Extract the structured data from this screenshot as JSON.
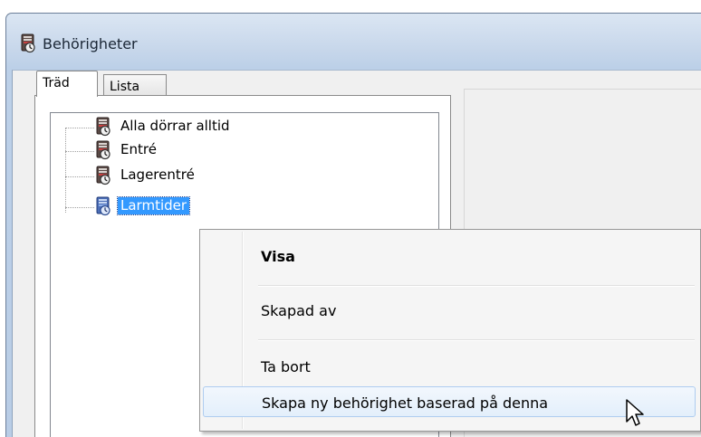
{
  "window": {
    "title": "Behörigheter",
    "icon": "access-permission-icon"
  },
  "tabs": [
    {
      "label": "Träd",
      "active": true
    },
    {
      "label": "Lista",
      "active": false
    }
  ],
  "tree": {
    "items": [
      {
        "label": "Alla dörrar alltid",
        "icon": "access-permission-icon",
        "selected": false
      },
      {
        "label": "Entré",
        "icon": "access-permission-icon",
        "selected": false
      },
      {
        "label": "Lagerentré",
        "icon": "access-permission-icon",
        "selected": false
      },
      {
        "label": "Larmtider",
        "icon": "access-permission-icon",
        "selected": true
      }
    ]
  },
  "context_menu": {
    "items": [
      {
        "label": "Visa",
        "bold": true
      },
      {
        "label": "Skapad av",
        "bold": false
      },
      {
        "label": "Ta bort",
        "bold": false
      },
      {
        "label": "Skapa ny behörighet baserad på denna",
        "bold": false,
        "hovered": true
      }
    ]
  },
  "colors": {
    "selection": "#3399ff",
    "titlebar": "#c6d6ea",
    "menu_hover_border": "#aeccf0"
  }
}
